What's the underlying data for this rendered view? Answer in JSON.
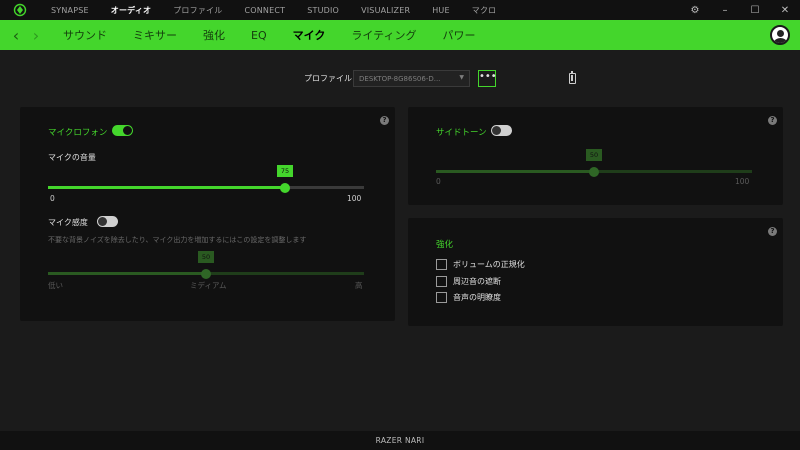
{
  "topnav": {
    "items": [
      "SYNAPSE",
      "オーディオ",
      "プロファイル",
      "CONNECT",
      "STUDIO",
      "VISUALIZER",
      "HUE",
      "マクロ"
    ],
    "active_index": 1
  },
  "window_controls": [
    "⚙",
    "–",
    "☐",
    "✕"
  ],
  "subnav": {
    "back_icon": "‹",
    "forward_icon": "›",
    "items": [
      "サウンド",
      "ミキサー",
      "強化",
      "EQ",
      "マイク",
      "ライティング",
      "パワー"
    ],
    "active_index": 4
  },
  "profile": {
    "label": "プロファイル",
    "selected": "DESKTOP-8G86S06-D...",
    "more_label": "•••"
  },
  "mic_panel": {
    "title": "マイクロフォン",
    "mic_on": true,
    "volume_label": "マイクの音量",
    "volume_value": "75",
    "volume": 75,
    "volume_min": "0",
    "volume_max": "100",
    "sensitivity_label": "マイク感度",
    "sensitivity_on": false,
    "sensitivity_desc": "不要な背景ノイズを除去したり、マイク出力を増加するにはこの設定を調整します",
    "sensitivity_value": "50",
    "sensitivity": 50,
    "sens_low": "低い",
    "sens_mid": "ミディアム",
    "sens_high": "高",
    "help": "?"
  },
  "sidetone_panel": {
    "title": "サイドトーン",
    "on": false,
    "value": "50",
    "level": 50,
    "min": "0",
    "max": "100",
    "help": "?"
  },
  "enhance_panel": {
    "title": "強化",
    "options": [
      "ボリュームの正規化",
      "周辺音の遮断",
      "音声の明瞭度"
    ],
    "help": "?"
  },
  "footer": {
    "device": "RAZER NARI"
  },
  "colors": {
    "accent": "#44d62c",
    "panel": "#111111",
    "background": "#1b1b1b"
  }
}
